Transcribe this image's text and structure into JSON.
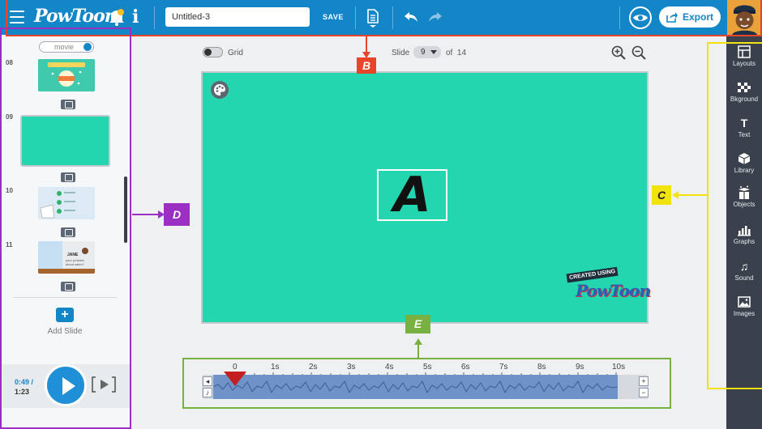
{
  "topbar": {
    "logo": "PowToon",
    "title_value": "Untitled-3",
    "save_label": "SAVE",
    "export_label": "Export"
  },
  "left_panel": {
    "movie_toggle_label": "movie",
    "slides": [
      {
        "number": "08"
      },
      {
        "number": "09"
      },
      {
        "number": "10"
      },
      {
        "number": "11"
      }
    ],
    "slide10_text": "JANE",
    "slide11_subtext": "your problem about sales?",
    "add_slide_icon": "+",
    "add_slide_label": "Add Slide",
    "current_time": "0:49 /",
    "total_time": "1:23"
  },
  "stage_toolbar": {
    "grid_label": "Grid",
    "slide_label": "Slide",
    "slide_value": "9",
    "of_label": "of",
    "total_slides": "14"
  },
  "stage": {
    "text": "A",
    "watermark_top": "CREATED USING",
    "watermark_logo": "PowToon"
  },
  "timeline": {
    "ticks": [
      "0",
      "1s",
      "2s",
      "3s",
      "4s",
      "5s",
      "6s",
      "7s",
      "8s",
      "9s",
      "10s"
    ],
    "plus_label": "+",
    "minus_label": "−"
  },
  "right_sidebar": {
    "items": [
      {
        "label": "Layouts",
        "icon": "layouts-icon"
      },
      {
        "label": "Bkground",
        "icon": "background-icon"
      },
      {
        "label": "Text",
        "icon": "text-icon"
      },
      {
        "label": "Library",
        "icon": "library-icon"
      },
      {
        "label": "Objects",
        "icon": "objects-icon"
      },
      {
        "label": "Graphs",
        "icon": "graphs-icon"
      },
      {
        "label": "Sound",
        "icon": "sound-icon"
      },
      {
        "label": "Images",
        "icon": "images-icon"
      }
    ]
  },
  "annotations": {
    "b": "B",
    "c": "C",
    "d": "D",
    "e": "E"
  },
  "colors": {
    "brand_blue": "#1386c8",
    "stage_teal": "#24d6b0",
    "sidebar_dark": "#3a414c",
    "anno_red": "#e8442a",
    "anno_purple": "#9b2fc4",
    "anno_yellow": "#f2e20e",
    "anno_green": "#78b042"
  }
}
